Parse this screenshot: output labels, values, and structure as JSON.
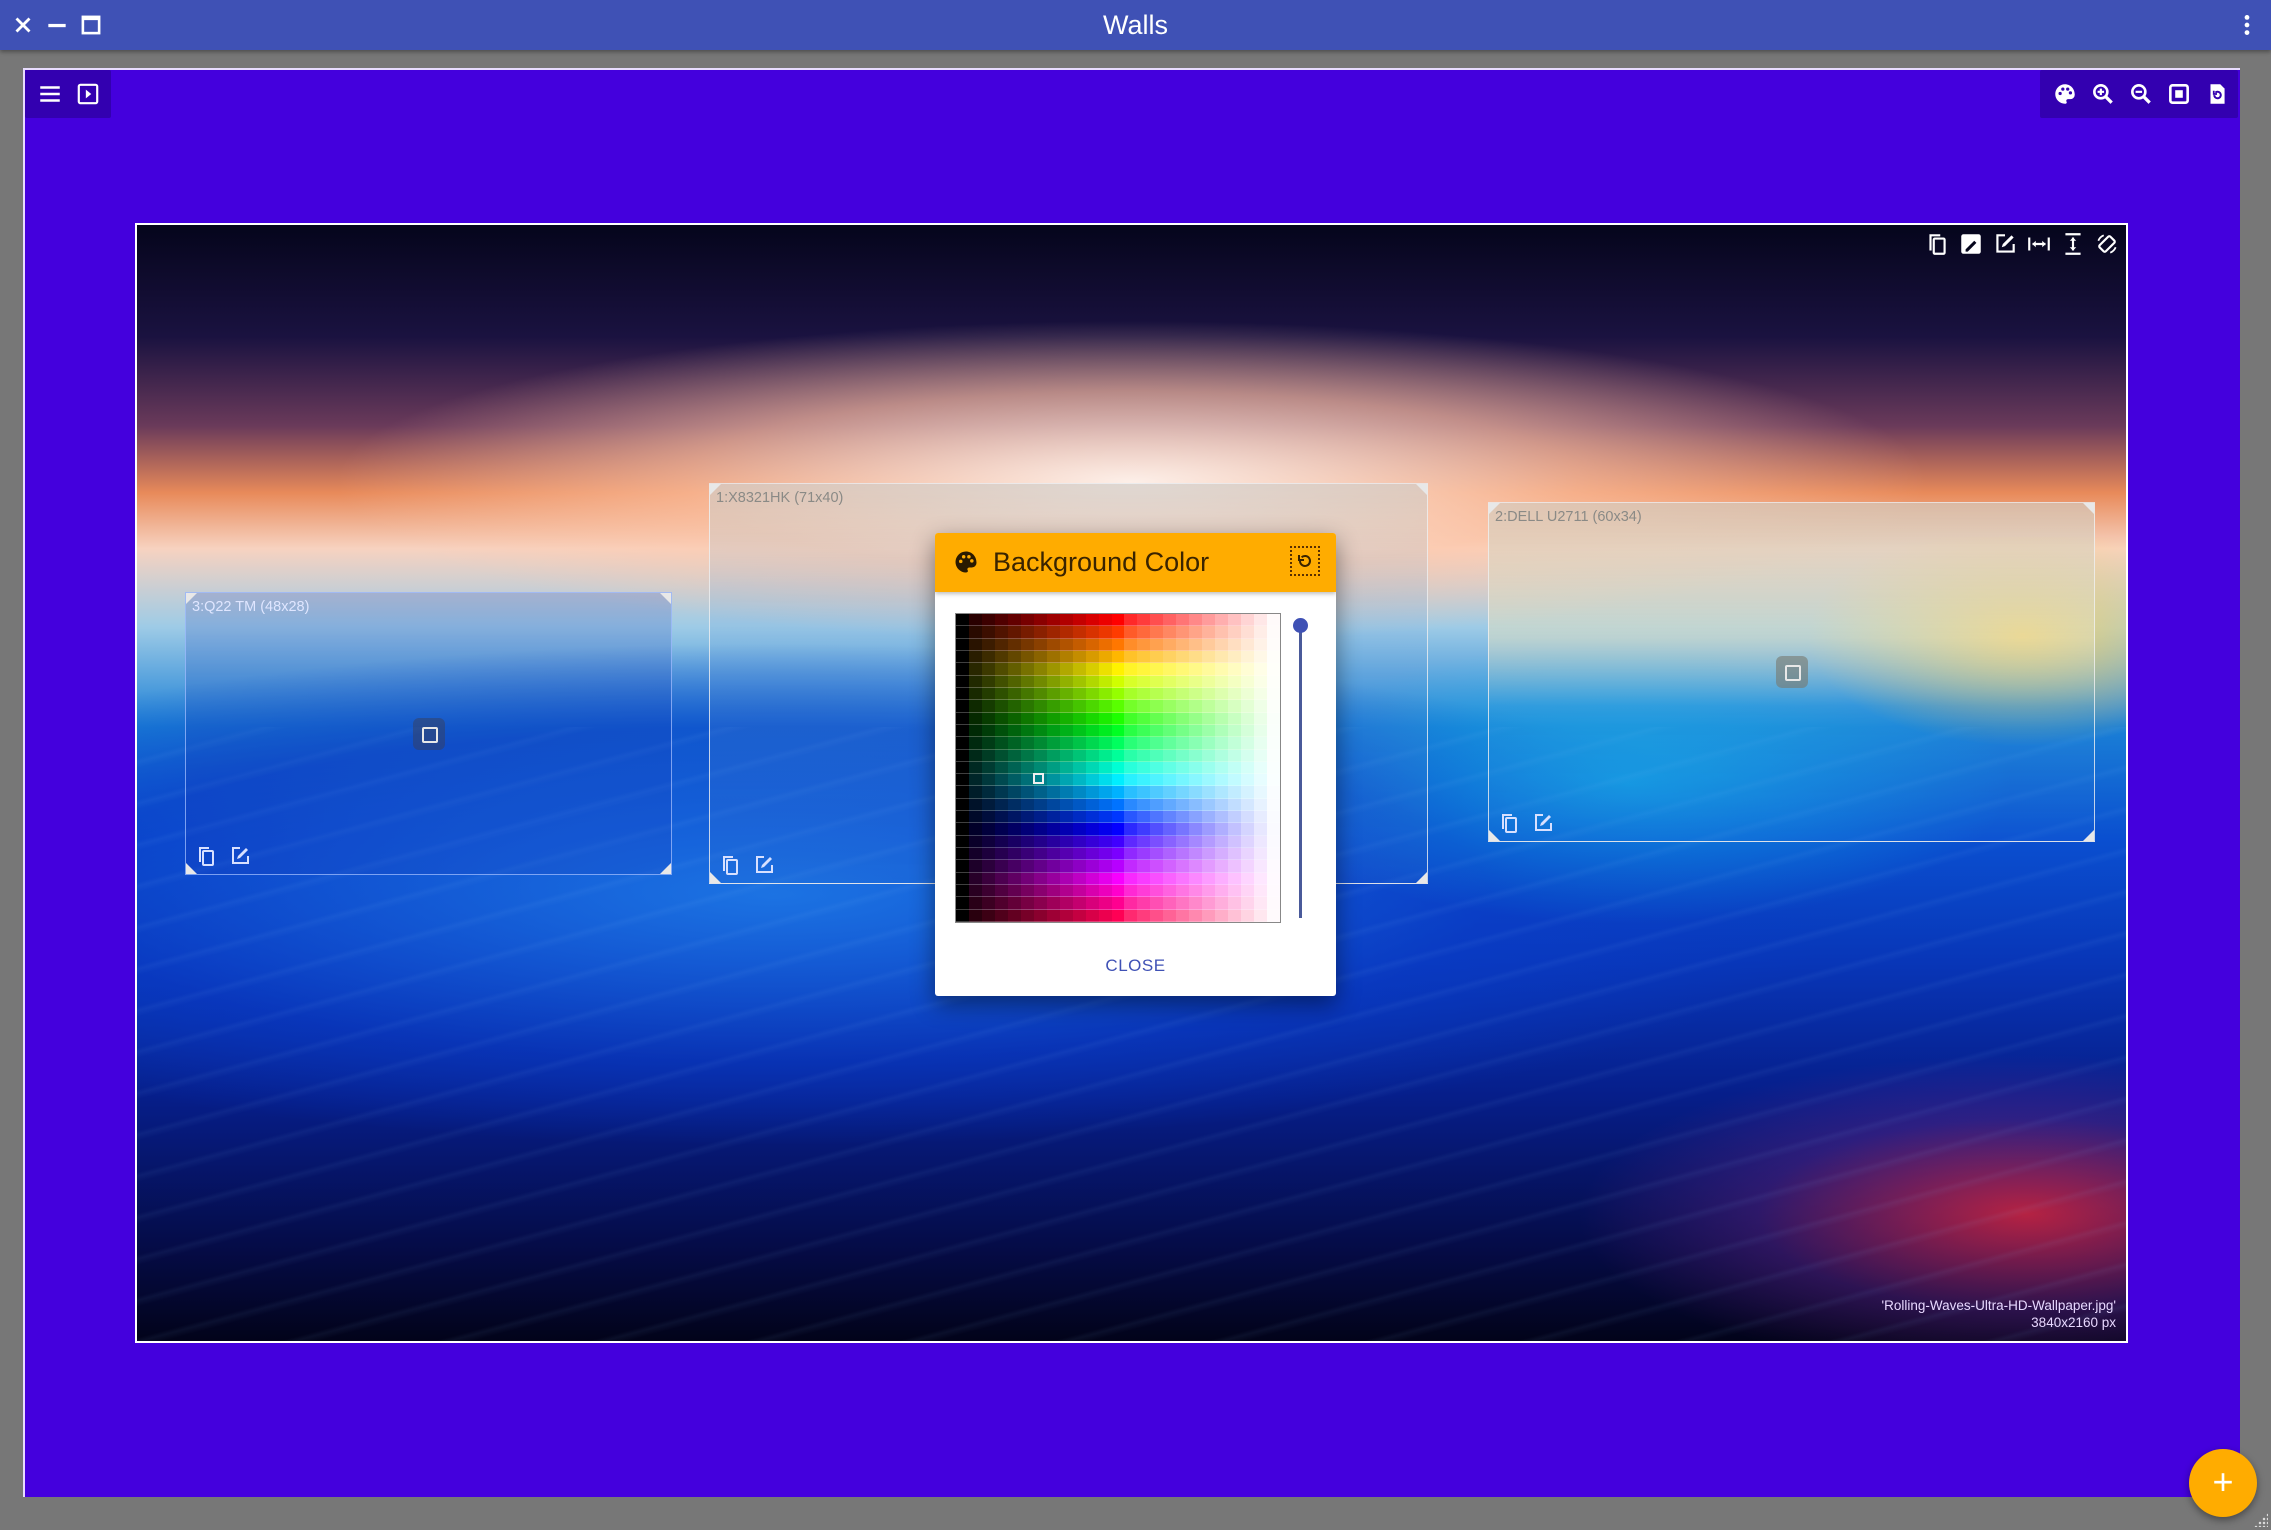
{
  "window": {
    "title": "Walls",
    "controls": {
      "close_icon": "close-icon",
      "minimize_icon": "minimize-icon",
      "maximize_icon": "maximize-icon",
      "menu_icon": "more-vert-icon"
    }
  },
  "colors": {
    "titlebar": "#3F51B5",
    "canvas_background": "#4400DD",
    "accent": "#FFAC00",
    "primary": "#3F51B5",
    "frame": "#777777"
  },
  "left_toolbar": {
    "items": [
      {
        "name": "menu",
        "icon": "hamburger-menu-icon"
      },
      {
        "name": "preview",
        "icon": "slideshow-icon"
      }
    ]
  },
  "right_toolbar": {
    "items": [
      {
        "name": "background-color",
        "icon": "palette-icon"
      },
      {
        "name": "zoom-in",
        "icon": "zoom-in-icon"
      },
      {
        "name": "zoom-out",
        "icon": "zoom-out-icon"
      },
      {
        "name": "fit",
        "icon": "fit-screen-icon"
      },
      {
        "name": "reset-layout",
        "icon": "restore-page-icon"
      }
    ]
  },
  "wallpaper": {
    "filename": "'Rolling-Waves-Ultra-HD-Wallpaper.jpg'",
    "resolution": "3840x2160 px",
    "tools": [
      {
        "name": "copy",
        "icon": "copy-icon"
      },
      {
        "name": "crop-edit",
        "icon": "image-edit-icon"
      },
      {
        "name": "edit",
        "icon": "edit-icon"
      },
      {
        "name": "fit-width",
        "icon": "fit-width-icon"
      },
      {
        "name": "fit-height",
        "icon": "fit-height-icon"
      },
      {
        "name": "rotate",
        "icon": "screen-rotation-icon"
      }
    ]
  },
  "monitors": [
    {
      "id": 3,
      "label": "3:Q22 TM (48x28)"
    },
    {
      "id": 1,
      "label": "1:X8321HK (71x40)"
    },
    {
      "id": 2,
      "label": "2:DELL U2711 (60x34)"
    }
  ],
  "monitor_tools": {
    "copy_icon": "copy-icon",
    "edit_icon": "edit-icon",
    "center_icon": "move-handle-icon"
  },
  "color_dialog": {
    "title": "Background Color",
    "title_icon": "palette-icon",
    "reset_icon": "reset-icon",
    "close_label": "CLOSE",
    "selected_color": "#0A50E0",
    "brightness_level": 1.0
  },
  "fab": {
    "label": "+",
    "icon": "add-icon"
  }
}
